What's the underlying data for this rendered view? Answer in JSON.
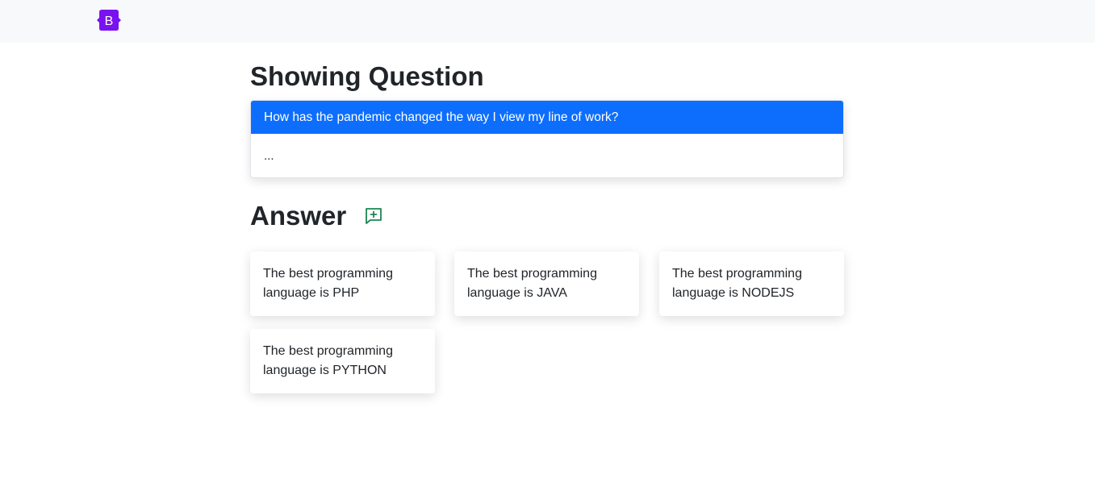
{
  "navbar": {
    "brand_letter": "B",
    "brand_color": "#7a12f0"
  },
  "page": {
    "title": "Showing Question"
  },
  "question": {
    "title": "How has the pandemic changed the way I view my line of work?",
    "body": "...",
    "header_color": "#0d6efd"
  },
  "answers_section": {
    "title": "Answer",
    "add_icon": "chat-plus-icon",
    "add_icon_color": "#198754"
  },
  "answers": [
    {
      "text": "The best programming language is PHP"
    },
    {
      "text": "The best programming language is JAVA"
    },
    {
      "text": "The best programming language is NODEJS"
    },
    {
      "text": "The best programming language is PYTHON"
    }
  ]
}
